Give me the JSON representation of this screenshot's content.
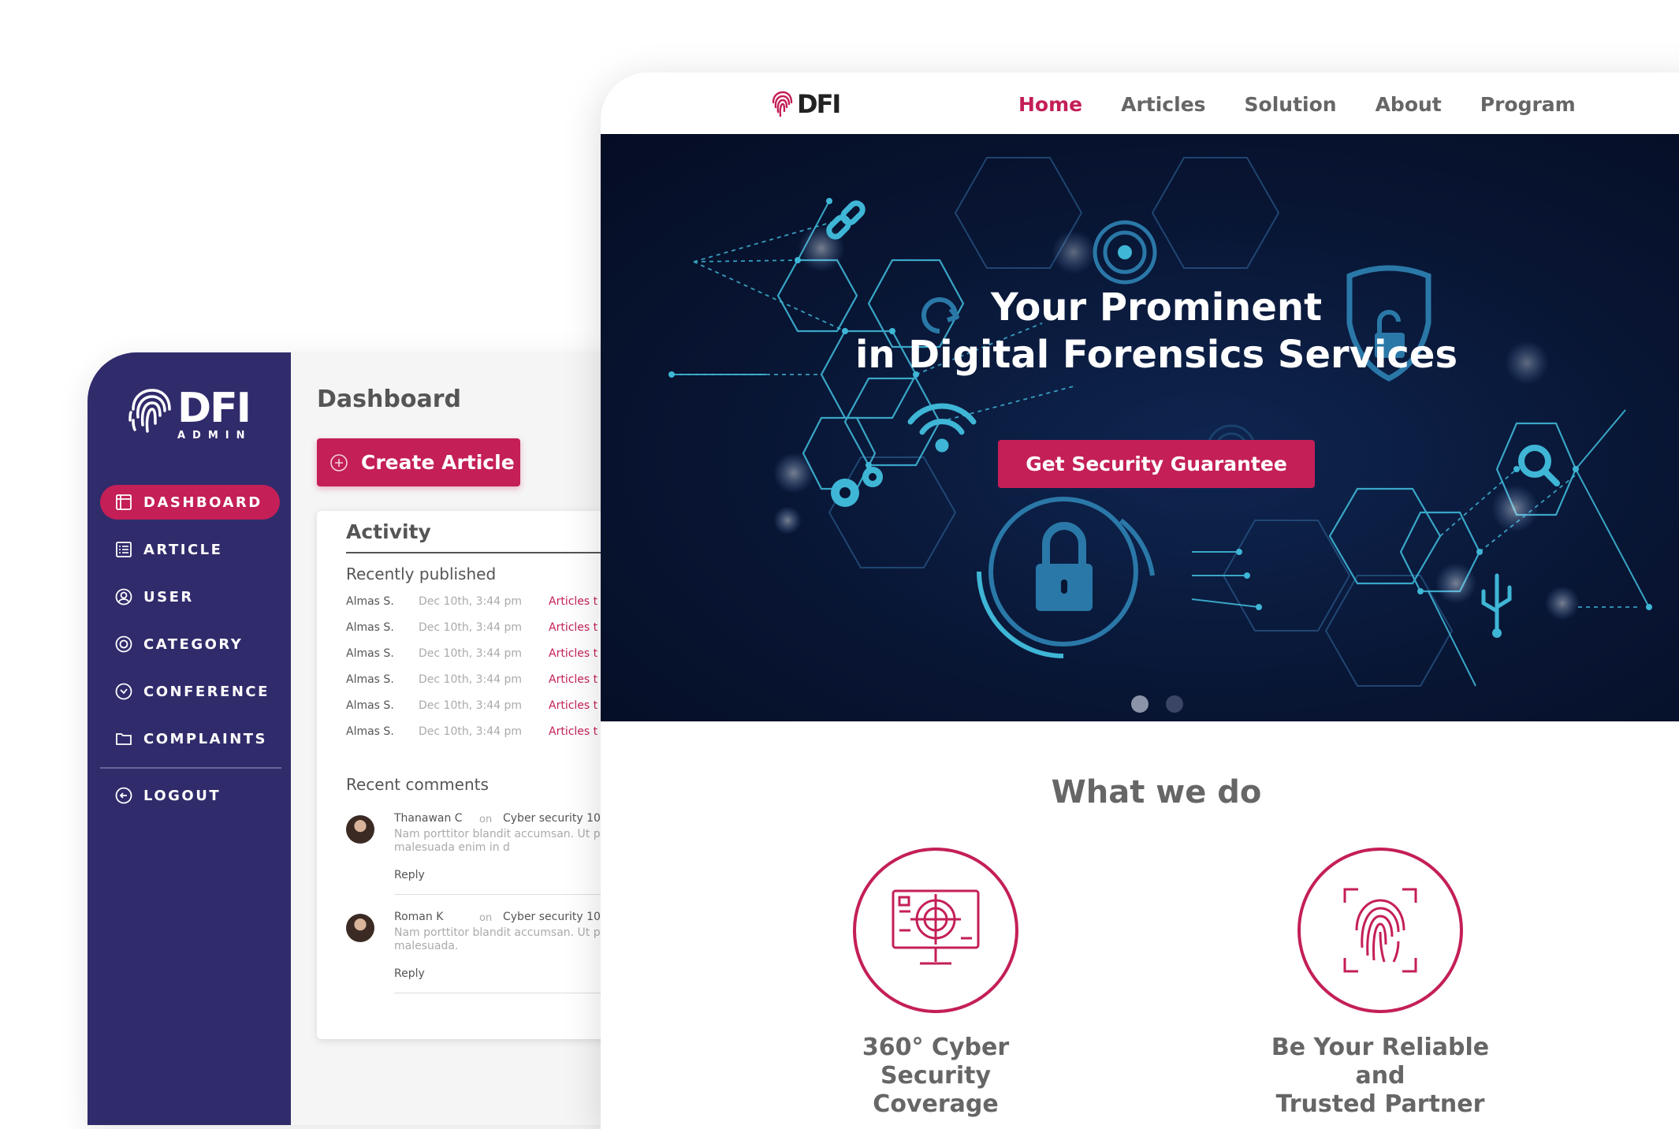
{
  "admin": {
    "brand": "DFI",
    "brand_sub": "ADMIN",
    "nav": [
      {
        "label": "DASHBOARD",
        "icon": "dashboard-icon",
        "active": true
      },
      {
        "label": "ARTICLE",
        "icon": "list-icon"
      },
      {
        "label": "USER",
        "icon": "user-icon"
      },
      {
        "label": "CATEGORY",
        "icon": "category-icon"
      },
      {
        "label": "CONFERENCE",
        "icon": "conference-icon"
      },
      {
        "label": "COMPLAINTS",
        "icon": "folder-icon"
      }
    ],
    "logout": "LOGOUT",
    "page_title": "Dashboard",
    "create_button": "Create Article",
    "activity": {
      "title": "Activity",
      "recent_published_title": "Recently published",
      "rows": [
        {
          "name": "Almas S.",
          "date": "Dec 10th, 3:44 pm",
          "article": "Articles t"
        },
        {
          "name": "Almas S.",
          "date": "Dec 10th, 3:44 pm",
          "article": "Articles t"
        },
        {
          "name": "Almas S.",
          "date": "Dec 10th, 3:44 pm",
          "article": "Articles t"
        },
        {
          "name": "Almas S.",
          "date": "Dec 10th, 3:44 pm",
          "article": "Articles t"
        },
        {
          "name": "Almas S.",
          "date": "Dec 10th, 3:44 pm",
          "article": "Articles t"
        },
        {
          "name": "Almas S.",
          "date": "Dec 10th, 3:44 pm",
          "article": "Articles t"
        }
      ],
      "recent_comments_title": "Recent comments",
      "comments": [
        {
          "name": "Thanawan C",
          "on": "on",
          "target": "Cyber security 10",
          "text": "Nam porttitor blandit accumsan. Ut pretium dui. In malesuada enim in d",
          "reply": "Reply"
        },
        {
          "name": "Roman K",
          "on": "on",
          "target": "Cyber security 10",
          "text": "Nam porttitor blandit accumsan. Ut pretium dui. In malesuada.",
          "reply": "Reply"
        }
      ]
    }
  },
  "site": {
    "brand": "DFI",
    "menu": [
      {
        "label": "Home",
        "active": true
      },
      {
        "label": "Articles"
      },
      {
        "label": "Solution"
      },
      {
        "label": "About"
      },
      {
        "label": "Program"
      }
    ],
    "hero": {
      "title_line1": "Your Prominent",
      "title_line2": "in Digital Forensics Services",
      "cta": "Get Security Guarantee",
      "slides": 2,
      "active_slide": 1
    },
    "section_title": "What we do",
    "features": [
      {
        "label_line1": "360° Cyber Security",
        "label_line2": "Coverage",
        "icon": "monitor-target-icon"
      },
      {
        "label_line1": "Be Your Reliable and",
        "label_line2": "Trusted Partner",
        "icon": "fingerprint-icon"
      }
    ]
  },
  "colors": {
    "accent": "#c41f57",
    "sidebar": "#302b6b",
    "hero_bg": "#081533",
    "cyan": "#3fb6d6"
  }
}
